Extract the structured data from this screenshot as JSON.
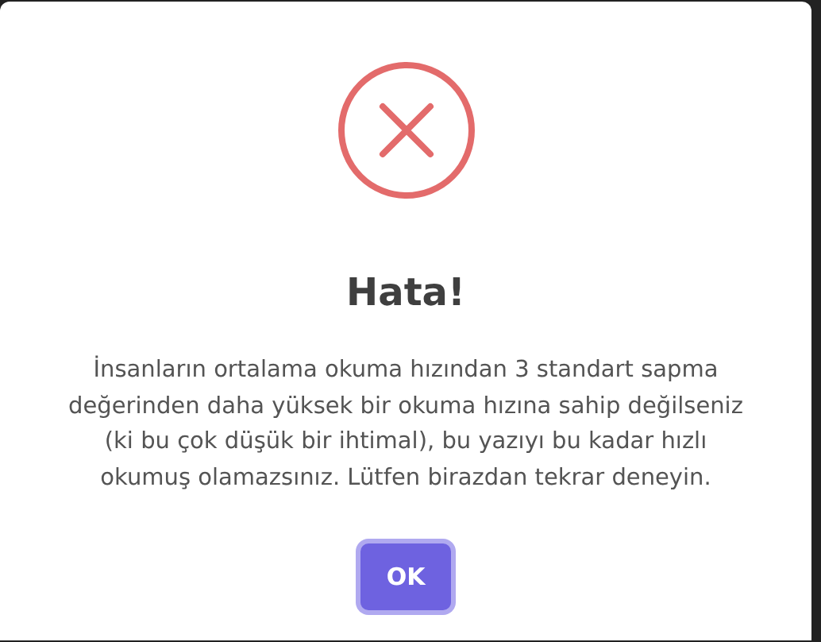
{
  "dialog": {
    "icon": {
      "kind": "error"
    },
    "title": "Hata!",
    "message": "İnsanların ortalama okuma hızından 3 standart sapma değerinden daha yüksek bir okuma hızına sahip değilseniz (ki bu çok düşük bir ihtimal), bu yazıyı bu kadar hızlı okumuş olamazsınız. Lütfen birazdan tekrar deneyin.",
    "buttons": [
      {
        "label": "OK",
        "focused": true
      }
    ]
  }
}
